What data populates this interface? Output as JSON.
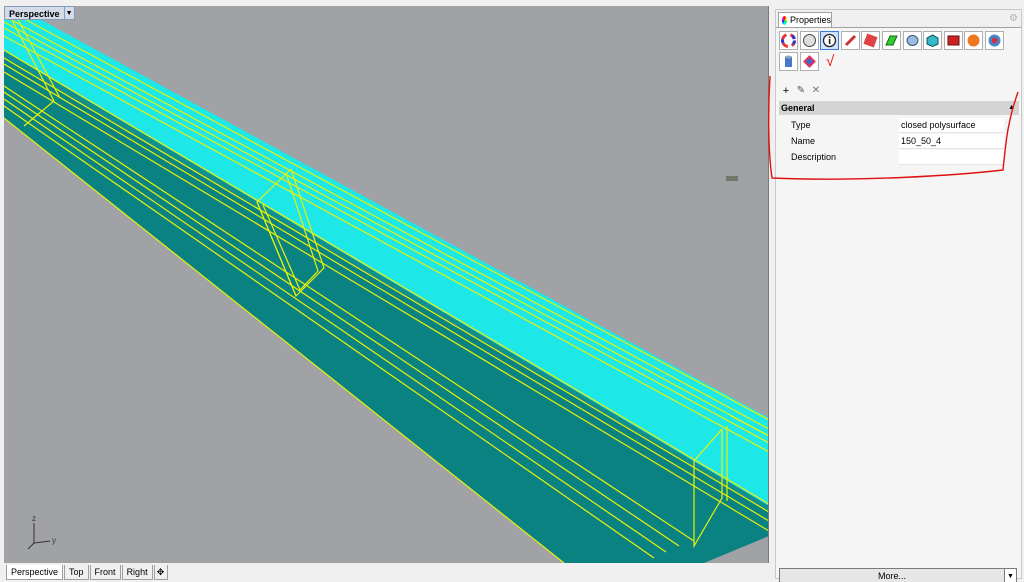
{
  "viewport": {
    "title": "Perspective",
    "dropdown_icon": "chevron-down-icon",
    "axis": {
      "z_label": "z",
      "y_label": "y"
    },
    "colors": {
      "background": "#a0a2a6",
      "top_face": "#1de7e7",
      "side_face": "#0b8282",
      "edges": "#e6f20a"
    }
  },
  "view_tabs": [
    {
      "label": "Perspective",
      "active": true
    },
    {
      "label": "Top",
      "active": false
    },
    {
      "label": "Front",
      "active": false
    },
    {
      "label": "Right",
      "active": false
    }
  ],
  "properties": {
    "tab_title": "Properties",
    "icons": [
      "material-icon",
      "display-icon",
      "info-icon",
      "pen-icon",
      "section-icon",
      "surface-icon",
      "mesh-icon",
      "cube-icon",
      "render-icon",
      "ball-icon",
      "texture-icon",
      "cylinder-icon",
      "grasshopper-icon"
    ],
    "tools": {
      "add": "+",
      "edit": "✎",
      "delete": "✕"
    },
    "section_title": "General",
    "rows": [
      {
        "name": "Type",
        "value": "closed polysurface"
      },
      {
        "name": "Name",
        "value": "150_50_4"
      },
      {
        "name": "Description",
        "value": ""
      }
    ],
    "more_label": "More...",
    "annotation_mark": "√"
  }
}
